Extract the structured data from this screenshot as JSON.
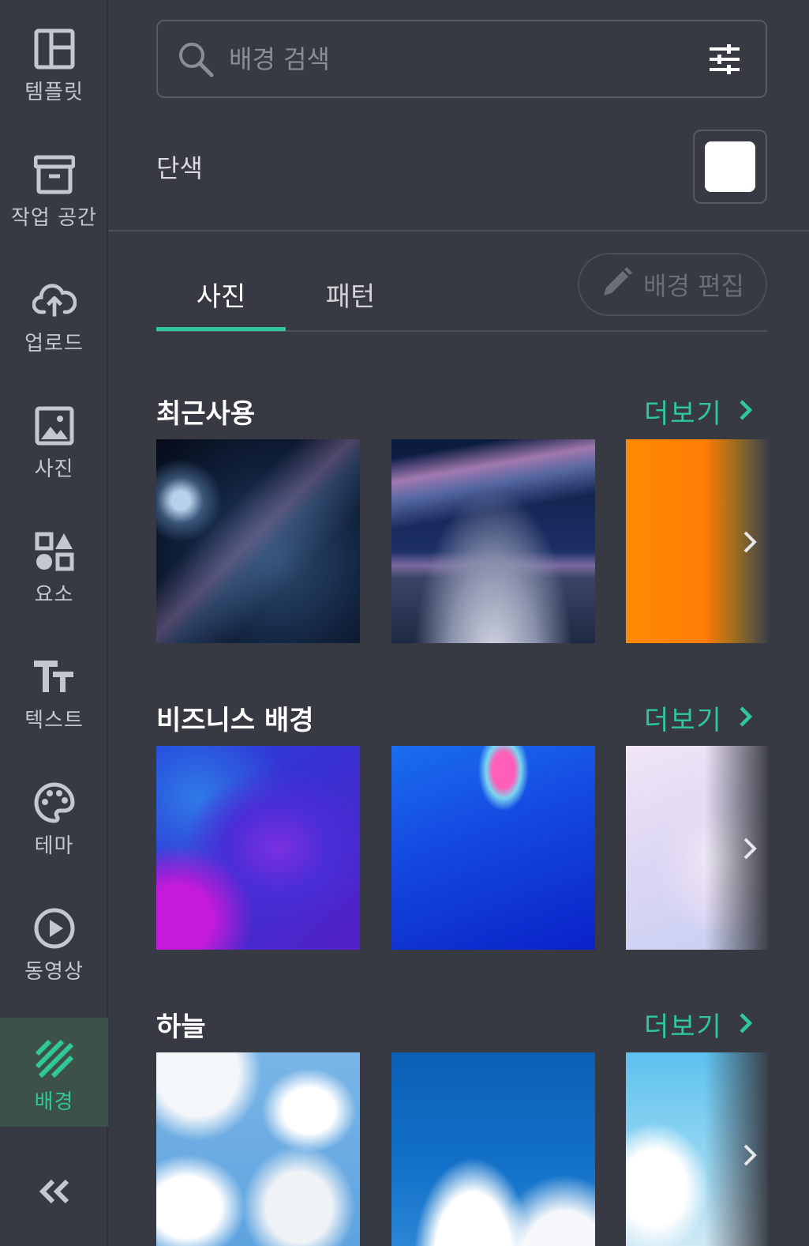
{
  "sidebar": {
    "items": [
      {
        "label": "템플릿",
        "icon": "template-icon"
      },
      {
        "label": "작업 공간",
        "icon": "archive-icon"
      },
      {
        "label": "업로드",
        "icon": "cloud-upload-icon"
      },
      {
        "label": "사진",
        "icon": "image-icon"
      },
      {
        "label": "요소",
        "icon": "shapes-icon"
      },
      {
        "label": "텍스트",
        "icon": "text-icon"
      },
      {
        "label": "테마",
        "icon": "palette-icon"
      },
      {
        "label": "동영상",
        "icon": "play-icon"
      },
      {
        "label": "배경",
        "icon": "background-stripes-icon",
        "active": true
      }
    ],
    "collapse_icon": "double-chevron-left-icon"
  },
  "search": {
    "placeholder": "배경 검색",
    "value": ""
  },
  "solid": {
    "label": "단색",
    "swatch_color": "#ffffff"
  },
  "tabs": {
    "items": [
      {
        "label": "사진",
        "active": true
      },
      {
        "label": "패턴",
        "active": false
      }
    ],
    "edit_button": "배경 편집"
  },
  "sections": [
    {
      "title": "최근사용",
      "more": "더보기"
    },
    {
      "title": "비즈니스 배경",
      "more": "더보기"
    },
    {
      "title": "하늘",
      "more": "더보기"
    }
  ],
  "colors": {
    "background": "#373a42",
    "accent": "#30c79a",
    "active_rail": "#3c5148"
  }
}
